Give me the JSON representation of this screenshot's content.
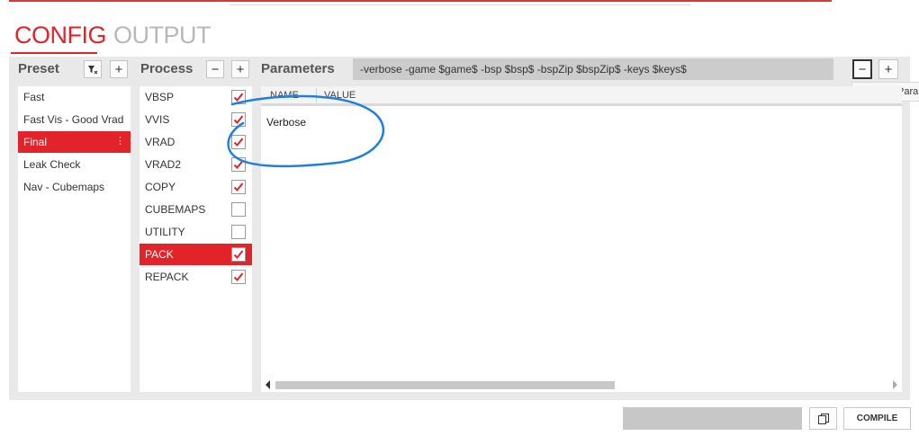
{
  "tabs": {
    "config": "CONFIG",
    "output": "OUTPUT"
  },
  "preset": {
    "title": "Preset",
    "items": [
      {
        "label": "Fast",
        "selected": false
      },
      {
        "label": "Fast Vis - Good Vrad",
        "selected": false
      },
      {
        "label": "Final",
        "selected": true
      },
      {
        "label": "Leak Check",
        "selected": false
      },
      {
        "label": "Nav - Cubemaps",
        "selected": false
      }
    ]
  },
  "process": {
    "title": "Process",
    "items": [
      {
        "label": "VBSP",
        "checked": true
      },
      {
        "label": "VVIS",
        "checked": true
      },
      {
        "label": "VRAD",
        "checked": true
      },
      {
        "label": "VRAD2",
        "checked": true
      },
      {
        "label": "COPY",
        "checked": true
      },
      {
        "label": "CUBEMAPS",
        "checked": false
      },
      {
        "label": "UTILITY",
        "checked": false
      },
      {
        "label": "PACK",
        "checked": true,
        "selected": true
      },
      {
        "label": "REPACK",
        "checked": true
      }
    ]
  },
  "parameters": {
    "title": "Parameters",
    "command": "-verbose -game $game$ -bsp $bsp$ -bspZip $bspZip$ -keys $keys$",
    "columns": {
      "name": "NAME",
      "value": "VALUE"
    },
    "rows": [
      {
        "name": "Verbose",
        "value": ""
      }
    ],
    "tooltip": "Remove Para"
  },
  "buttons": {
    "compile": "COMPILE"
  },
  "icons": {
    "filter": "filter-clear-icon",
    "add": "plus-icon",
    "remove": "minus-icon",
    "copy": "copy-icon",
    "kebab": "kebab-menu-icon"
  },
  "colors": {
    "accent": "#e2232a",
    "annotation": "#1e7fe0"
  }
}
